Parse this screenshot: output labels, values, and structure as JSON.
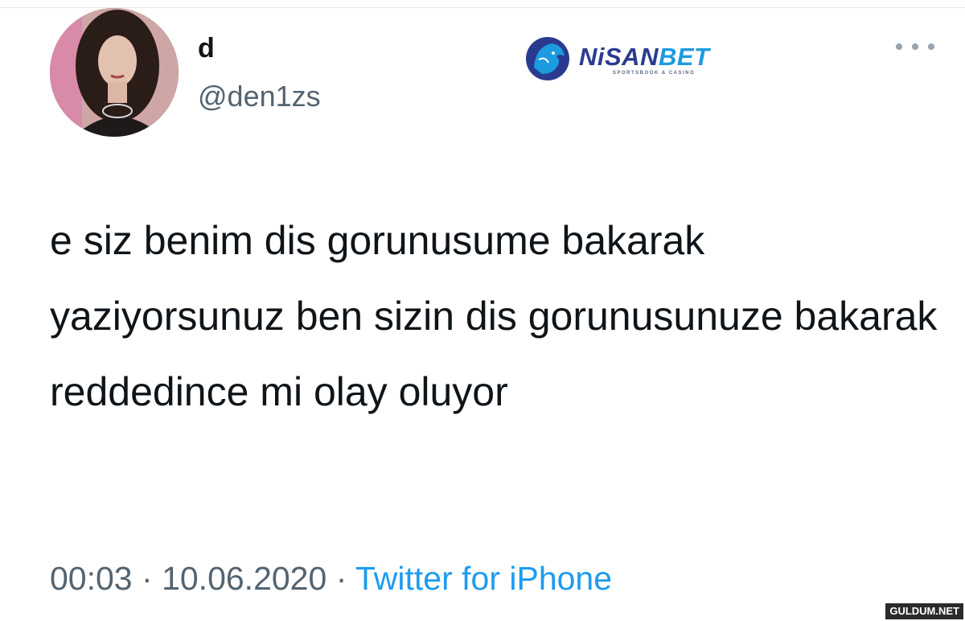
{
  "user": {
    "display_name": "d",
    "handle": "@den1zs"
  },
  "brand": {
    "word_part_1": "NiSAN",
    "word_part_2": "BET",
    "tagline": "SPORTSBOOK & CASINO",
    "icon": "lion-icon",
    "colors": {
      "primary": "#2a3b8f",
      "accent": "#1c9be0"
    }
  },
  "tweet": {
    "text": "e siz benim dis gorunusume bakarak yaziyorsunuz ben sizin dis gorunusunuze bakarak reddedince mi olay oluyor"
  },
  "meta": {
    "time": "00:03",
    "separator": "·",
    "date": "10.06.2020",
    "source": "Twitter for iPhone"
  },
  "icons": {
    "more": "more-icon"
  },
  "watermark": "GULDUM.NET",
  "colors": {
    "text": "#0f1419",
    "muted": "#536471",
    "link": "#1d9bf0"
  }
}
